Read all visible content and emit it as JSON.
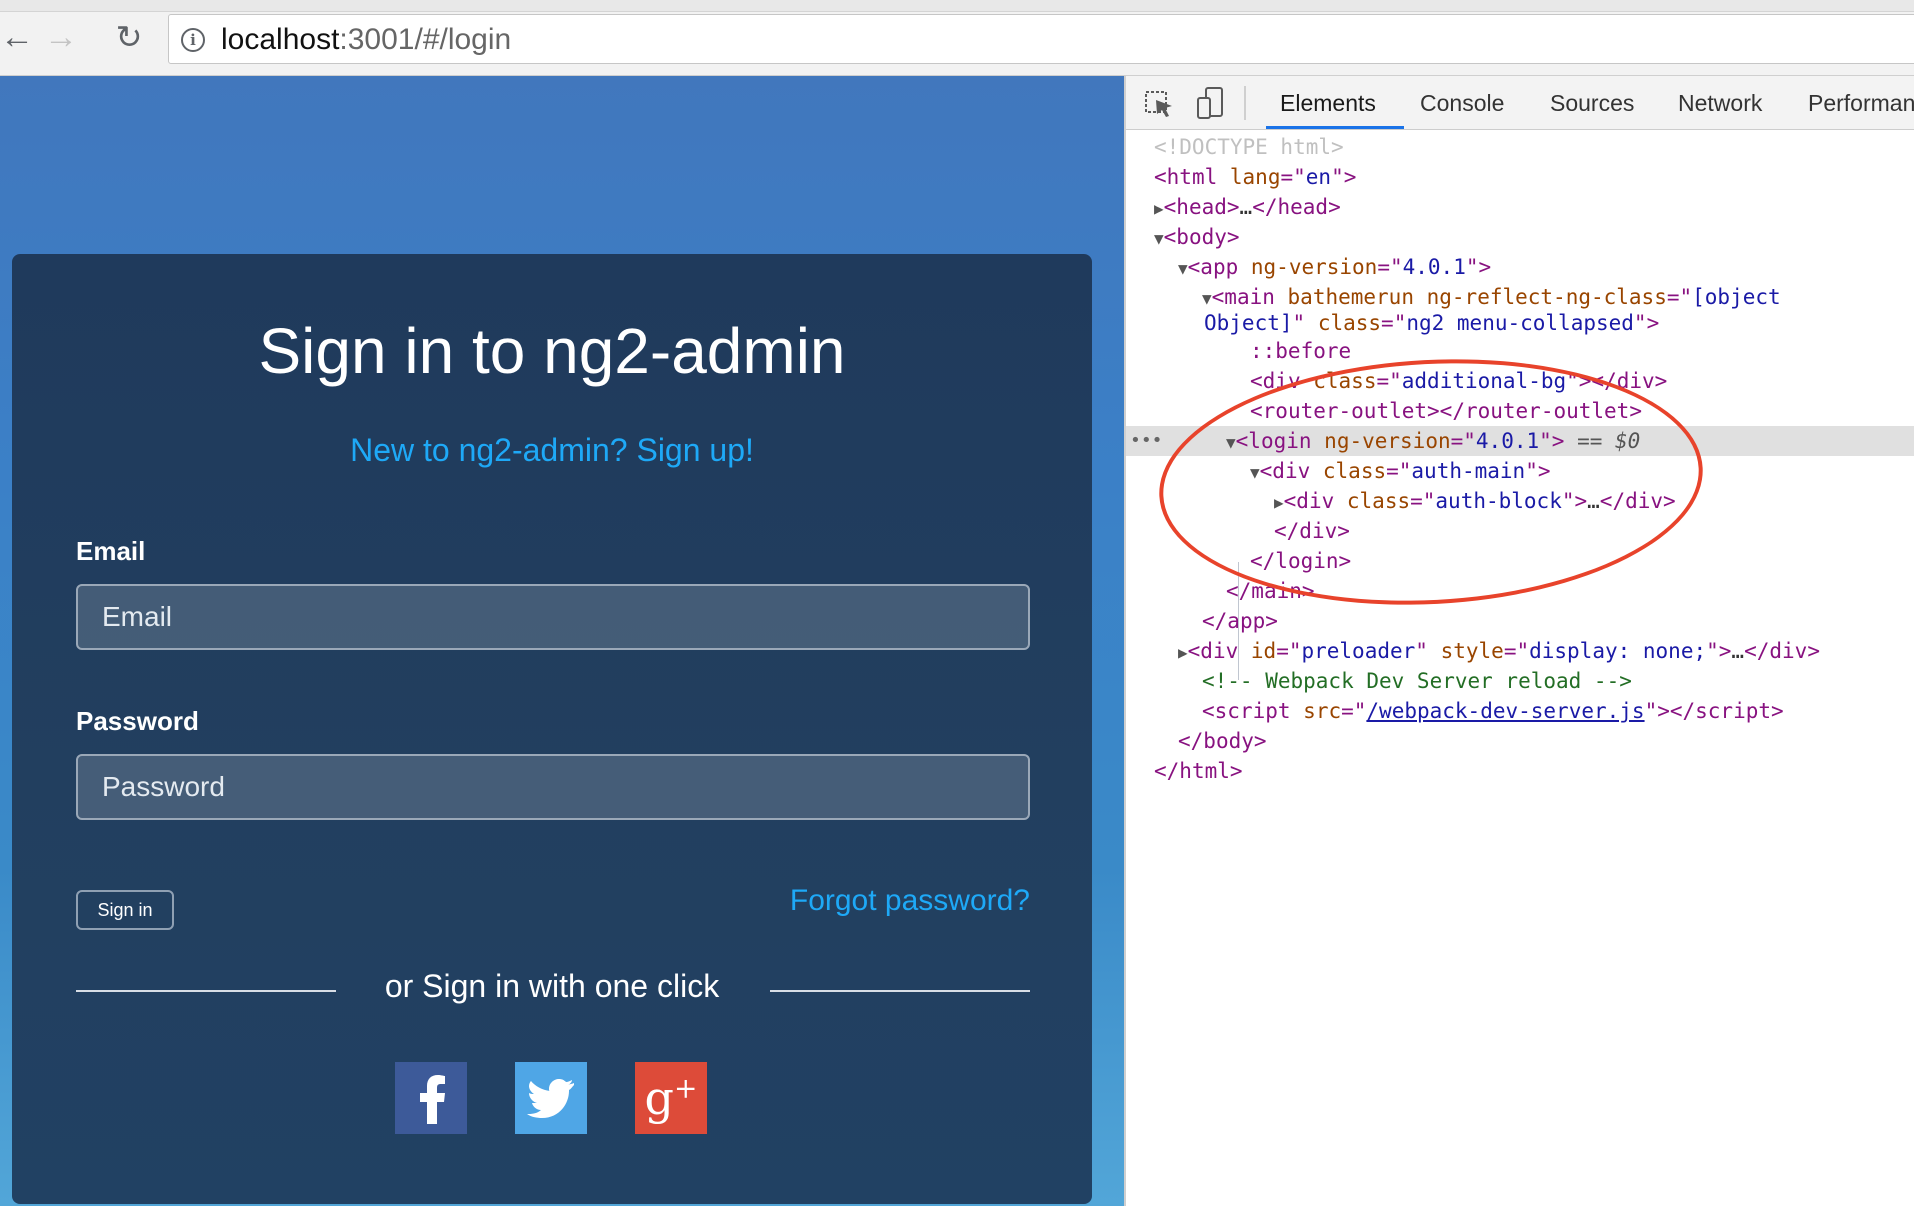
{
  "browser": {
    "url_host": "localhost",
    "url_path": ":3001/#/login"
  },
  "login": {
    "title": "Sign in to ng2-admin",
    "signup_link": "New to ng2-admin? Sign up!",
    "email_label": "Email",
    "email_placeholder": "Email",
    "password_label": "Password",
    "password_placeholder": "Password",
    "signin_button": "Sign in",
    "forgot_link": "Forgot password?",
    "social_caption": "or Sign in with one click",
    "social": [
      {
        "name": "facebook",
        "glyph": "f"
      },
      {
        "name": "twitter",
        "glyph": "twitter-bird"
      },
      {
        "name": "google-plus",
        "glyph": "g+"
      }
    ],
    "colors": {
      "link": "#1ea9f7",
      "card": "#223f5f",
      "facebook": "#3d5a99",
      "twitter": "#4fa6e6",
      "google_plus": "#dd4b39"
    }
  },
  "devtools": {
    "tabs": [
      "Elements",
      "Console",
      "Sources",
      "Network",
      "Performan"
    ],
    "active_tab": "Elements",
    "dom": {
      "doctype": "<!DOCTYPE html>",
      "html_open": "html",
      "html_lang_attr": "lang",
      "html_lang_val": "en",
      "head_tag": "head",
      "body_tag": "body",
      "app_tag": "app",
      "app_attr": "ng-version",
      "app_val": "4.0.1",
      "main_tag": "main",
      "main_attr1": "bathemerun",
      "main_attr2": "ng-reflect-ng-class",
      "main_val2_a": "[object",
      "main_val2_b": "Object]",
      "main_attr3": "class",
      "main_val3": "ng2 menu-collapsed",
      "before": "::before",
      "div_tag": "div",
      "class_attr": "class",
      "additional_bg": "additional-bg",
      "router_outlet": "router-outlet",
      "login_tag": "login",
      "login_attr": "ng-version",
      "login_val": "4.0.1",
      "selected_marker": "== $0",
      "auth_main": "auth-main",
      "auth_block": "auth-block",
      "preloader_id_attr": "id",
      "preloader_id": "preloader",
      "preloader_style_attr": "style",
      "preloader_style": "display: none;",
      "comment": "<!-- Webpack Dev Server reload -->",
      "script_tag": "script",
      "script_src_attr": "src",
      "script_src": "/webpack-dev-server.js"
    },
    "annotation_color": "#e8432b"
  }
}
